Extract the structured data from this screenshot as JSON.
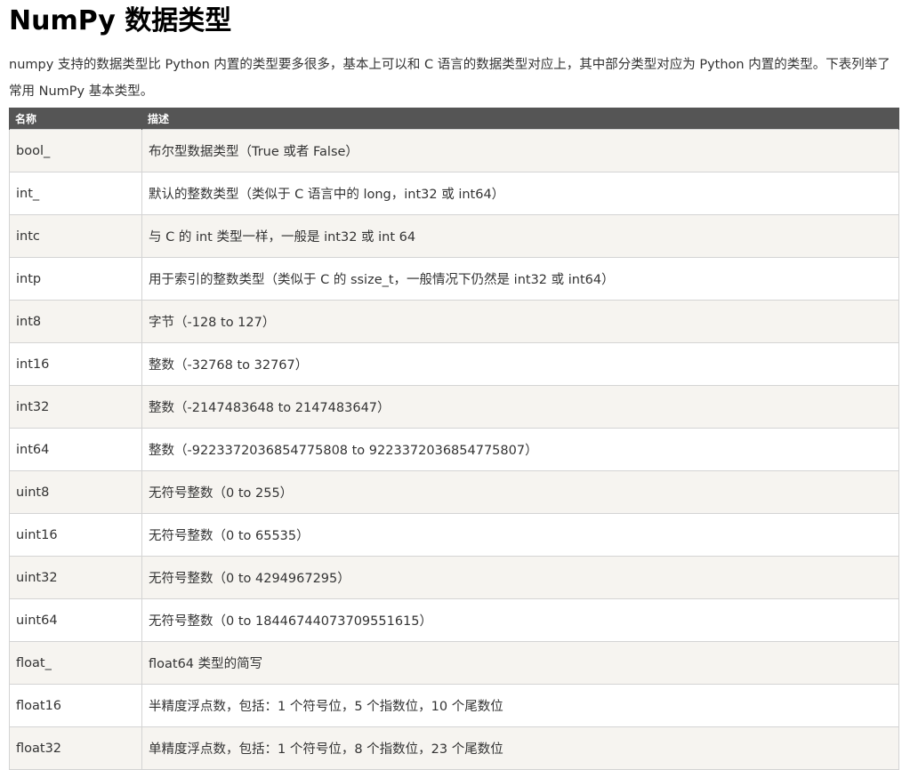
{
  "page": {
    "title": "NumPy 数据类型",
    "intro": "numpy 支持的数据类型比 Python 内置的类型要多很多，基本上可以和 C 语言的数据类型对应上，其中部分类型对应为 Python 内置的类型。下表列举了常用 NumPy 基本类型。"
  },
  "table": {
    "headers": [
      "名称",
      "描述"
    ],
    "rows": [
      {
        "name": "bool_",
        "desc": "布尔型数据类型（True 或者 False）"
      },
      {
        "name": "int_",
        "desc": "默认的整数类型（类似于 C 语言中的 long，int32 或 int64）"
      },
      {
        "name": "intc",
        "desc": "与 C 的 int 类型一样，一般是 int32 或 int 64"
      },
      {
        "name": "intp",
        "desc": "用于索引的整数类型（类似于 C 的 ssize_t，一般情况下仍然是 int32 或 int64）"
      },
      {
        "name": "int8",
        "desc": "字节（-128 to 127）"
      },
      {
        "name": "int16",
        "desc": "整数（-32768 to 32767）"
      },
      {
        "name": "int32",
        "desc": "整数（-2147483648 to 2147483647）"
      },
      {
        "name": "int64",
        "desc": "整数（-9223372036854775808 to 9223372036854775807）"
      },
      {
        "name": "uint8",
        "desc": "无符号整数（0 to 255）"
      },
      {
        "name": "uint16",
        "desc": "无符号整数（0 to 65535）"
      },
      {
        "name": "uint32",
        "desc": "无符号整数（0 to 4294967295）"
      },
      {
        "name": "uint64",
        "desc": "无符号整数（0 to 18446744073709551615）"
      },
      {
        "name": "float_",
        "desc": "float64 类型的简写"
      },
      {
        "name": "float16",
        "desc": "半精度浮点数，包括：1 个符号位，5 个指数位，10 个尾数位"
      },
      {
        "name": "float32",
        "desc": "单精度浮点数，包括：1 个符号位，8 个指数位，23 个尾数位"
      }
    ]
  }
}
